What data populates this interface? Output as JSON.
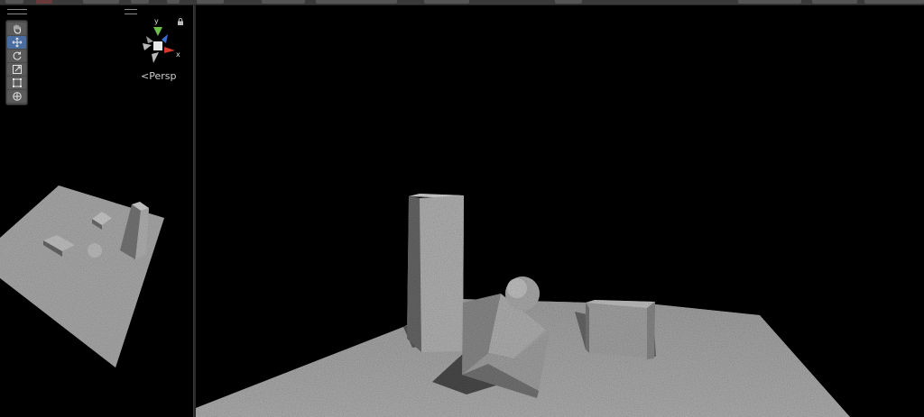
{
  "scene_view": {
    "camera_mode": "Persp",
    "gizmo_axes": {
      "y": "y",
      "x": "x"
    },
    "tools": [
      {
        "name": "hand-tool",
        "icon": "hand-icon",
        "active": false
      },
      {
        "name": "move-tool",
        "icon": "move-icon",
        "active": true
      },
      {
        "name": "rotate-tool",
        "icon": "rotate-icon",
        "active": false
      },
      {
        "name": "scale-tool",
        "icon": "scale-icon",
        "active": false
      },
      {
        "name": "rect-tool",
        "icon": "rect-icon",
        "active": false
      },
      {
        "name": "transform-tool",
        "icon": "transform-icon",
        "active": false
      }
    ]
  },
  "colors": {
    "background": "#000000",
    "floor": "#a9a9a9",
    "active_tool": "#4a6da0",
    "gizmo_y": "#6cc04a",
    "gizmo_x": "#d03a2a",
    "gizmo_z": "#3a6fd0"
  }
}
